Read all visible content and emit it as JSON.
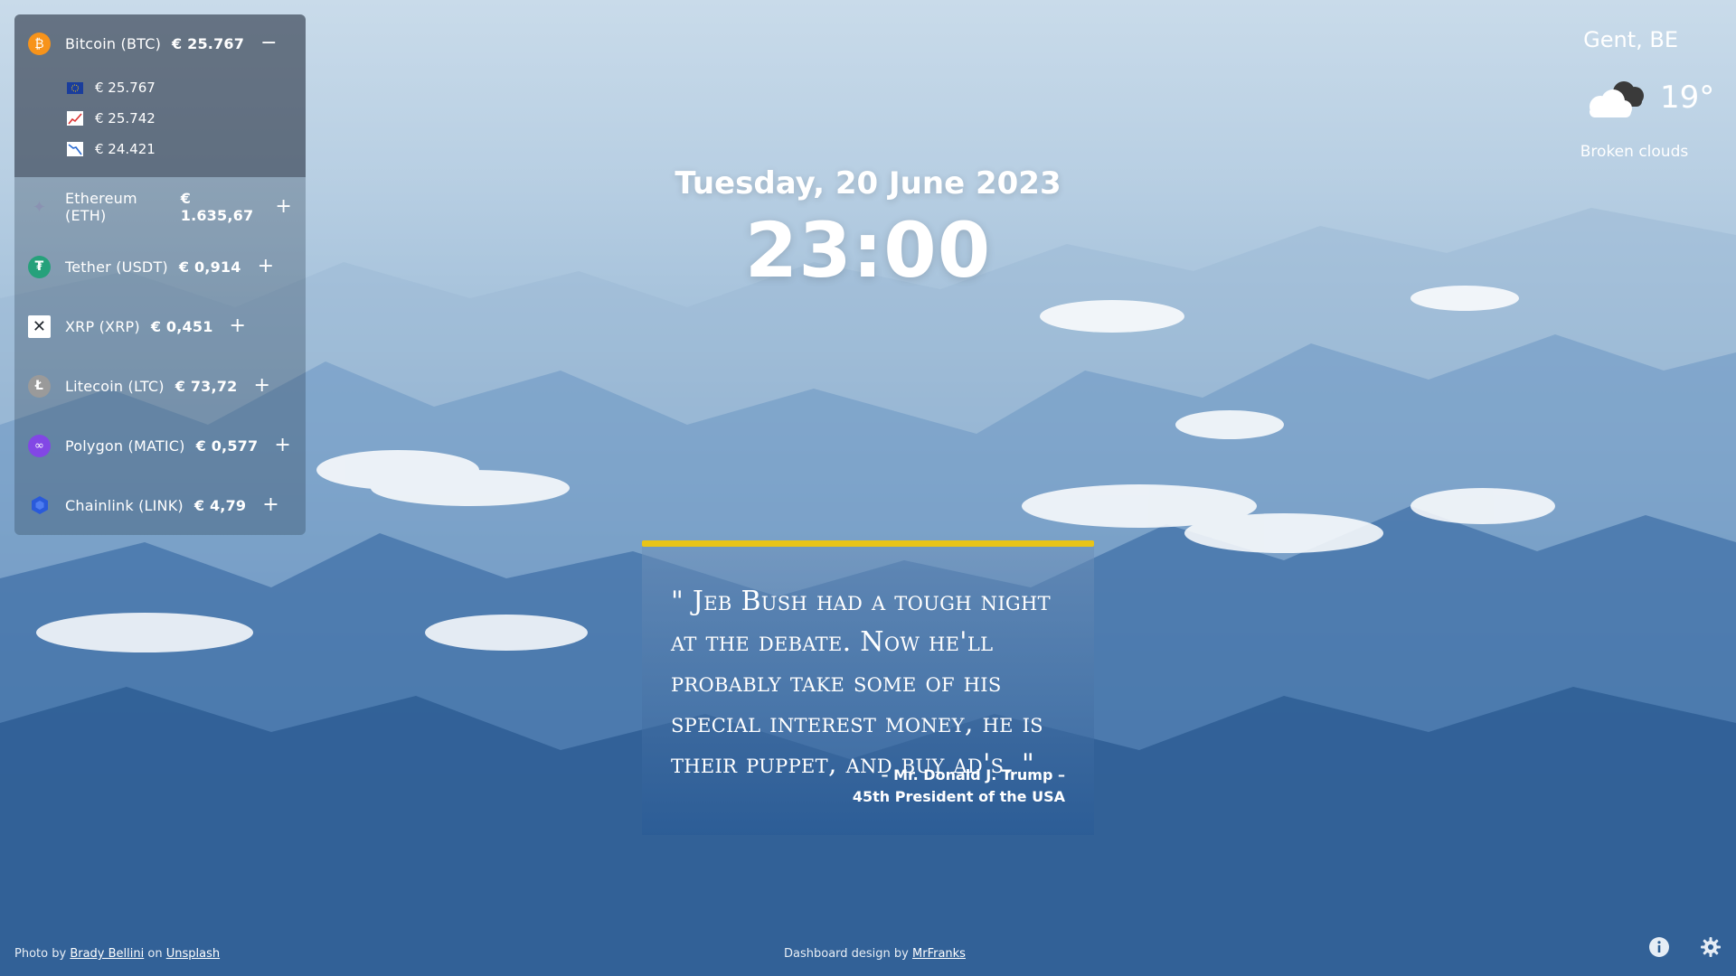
{
  "crypto": {
    "expanded": {
      "name": "Bitcoin (BTC)",
      "price": "€ 25.767",
      "toggle": "−",
      "details": [
        {
          "icon": "eu-flag-icon",
          "value": "€ 25.767"
        },
        {
          "icon": "chart-up-icon",
          "value": "€ 25.742"
        },
        {
          "icon": "chart-down-icon",
          "value": "€ 24.421"
        }
      ]
    },
    "coins": [
      {
        "name": "Ethereum (ETH)",
        "price": "€ 1.635,67",
        "toggle": "+"
      },
      {
        "name": "Tether (USDT)",
        "price": "€ 0,914",
        "toggle": "+"
      },
      {
        "name": "XRP (XRP)",
        "price": "€ 0,451",
        "toggle": "+"
      },
      {
        "name": "Litecoin (LTC)",
        "price": "€ 73,72",
        "toggle": "+"
      },
      {
        "name": "Polygon (MATIC)",
        "price": "€ 0,577",
        "toggle": "+"
      },
      {
        "name": "Chainlink (LINK)",
        "price": "€ 4,79",
        "toggle": "+"
      }
    ]
  },
  "clock": {
    "date": "Tuesday, 20 June 2023",
    "time": "23:00"
  },
  "weather": {
    "city": "Gent, BE",
    "temperature": "19°",
    "description": "Broken clouds",
    "icon": "cloud-icon"
  },
  "quote": {
    "text": "\" Jeb Bush had a tough night at the debate. Now he'll probably take some of his special interest money, he is their puppet, and buy ad's. \"",
    "author_line1": "– Mr. Donald J. Trump –",
    "author_line2": "45th President of the USA",
    "accent_color": "#e9c419"
  },
  "footer": {
    "photo_prefix": "Photo by",
    "photographer": "Brady Bellini",
    "on_word": "on",
    "source": "Unsplash",
    "design_prefix": "Dashboard design by",
    "designer": "MrFranks"
  }
}
